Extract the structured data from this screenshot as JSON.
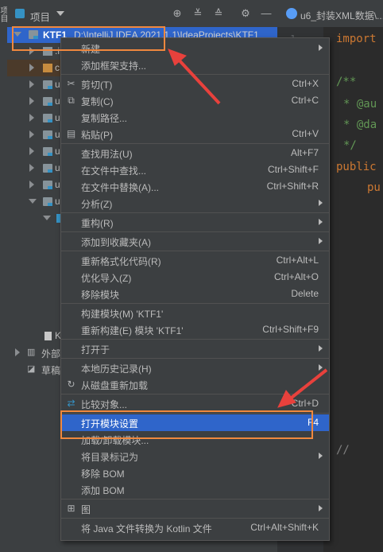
{
  "side_strip": {
    "label": "项目"
  },
  "project_panel": {
    "title": "项目",
    "toolbar_icons": [
      "target-icon",
      "expand-all-icon",
      "collapse-all-icon",
      "gear-icon",
      "minimize-icon"
    ]
  },
  "editor_tab": {
    "label": "u6_封装XML数据\\..."
  },
  "tree": {
    "root_name": "KTF1",
    "root_path": "D:\\IntelliJ IDEA 2021.1.1\\IdeaProjects\\KTF1",
    "items": [
      {
        "label": ".i"
      },
      {
        "label": "c"
      },
      {
        "label": "u"
      },
      {
        "label": "u"
      },
      {
        "label": "u"
      },
      {
        "label": "u"
      },
      {
        "label": "u"
      },
      {
        "label": "u"
      },
      {
        "label": "u"
      },
      {
        "label": "u"
      },
      {
        "label": "K"
      }
    ],
    "external_libs": "外部",
    "scratches": "草稿"
  },
  "editor": {
    "line_number": "1",
    "code_lines": [
      "import",
      "/**",
      "* @au",
      "* @da",
      "*/",
      "public",
      "pu",
      "//"
    ]
  },
  "context_menu": {
    "items": [
      {
        "label": "新建",
        "shortcut": "",
        "submenu": true
      },
      {
        "label": "添加框架支持...",
        "shortcut": ""
      },
      {
        "label": "剪切(T)",
        "shortcut": "Ctrl+X",
        "icon": "cut-icon"
      },
      {
        "label": "复制(C)",
        "shortcut": "Ctrl+C",
        "icon": "copy-icon"
      },
      {
        "label": "复制路径...",
        "shortcut": ""
      },
      {
        "label": "粘贴(P)",
        "shortcut": "Ctrl+V",
        "icon": "paste-icon"
      },
      {
        "label": "查找用法(U)",
        "shortcut": "Alt+F7"
      },
      {
        "label": "在文件中查找...",
        "shortcut": "Ctrl+Shift+F"
      },
      {
        "label": "在文件中替换(A)...",
        "shortcut": "Ctrl+Shift+R"
      },
      {
        "label": "分析(Z)",
        "shortcut": "",
        "submenu": true
      },
      {
        "label": "重构(R)",
        "shortcut": "",
        "submenu": true
      },
      {
        "label": "添加到收藏夹(A)",
        "shortcut": "",
        "submenu": true
      },
      {
        "label": "重新格式化代码(R)",
        "shortcut": "Ctrl+Alt+L"
      },
      {
        "label": "优化导入(Z)",
        "shortcut": "Ctrl+Alt+O"
      },
      {
        "label": "移除模块",
        "shortcut": "Delete"
      },
      {
        "label": "构建模块(M) 'KTF1'",
        "shortcut": ""
      },
      {
        "label": "重新构建(E) 模块 'KTF1'",
        "shortcut": "Ctrl+Shift+F9"
      },
      {
        "label": "打开于",
        "shortcut": "",
        "submenu": true
      },
      {
        "label": "本地历史记录(H)",
        "shortcut": "",
        "submenu": true
      },
      {
        "label": "从磁盘重新加载",
        "shortcut": "",
        "icon": "reload-icon"
      },
      {
        "label": "比较对象...",
        "shortcut": "Ctrl+D",
        "icon": "compare-icon"
      },
      {
        "label": "打开模块设置",
        "shortcut": "F4",
        "selected": true
      },
      {
        "label": "加载/卸载模块...",
        "shortcut": ""
      },
      {
        "label": "将目录标记为",
        "shortcut": "",
        "submenu": true
      },
      {
        "label": "移除 BOM",
        "shortcut": ""
      },
      {
        "label": "添加 BOM",
        "shortcut": ""
      },
      {
        "label": "图",
        "shortcut": "",
        "submenu": true,
        "icon": "diagram-icon"
      },
      {
        "label": "将 Java 文件转换为 Kotlin 文件",
        "shortcut": "Ctrl+Alt+Shift+K"
      }
    ]
  },
  "colors": {
    "selection": "#2f65ca",
    "annotation": "#f0883e",
    "arrow": "#e8413c"
  }
}
